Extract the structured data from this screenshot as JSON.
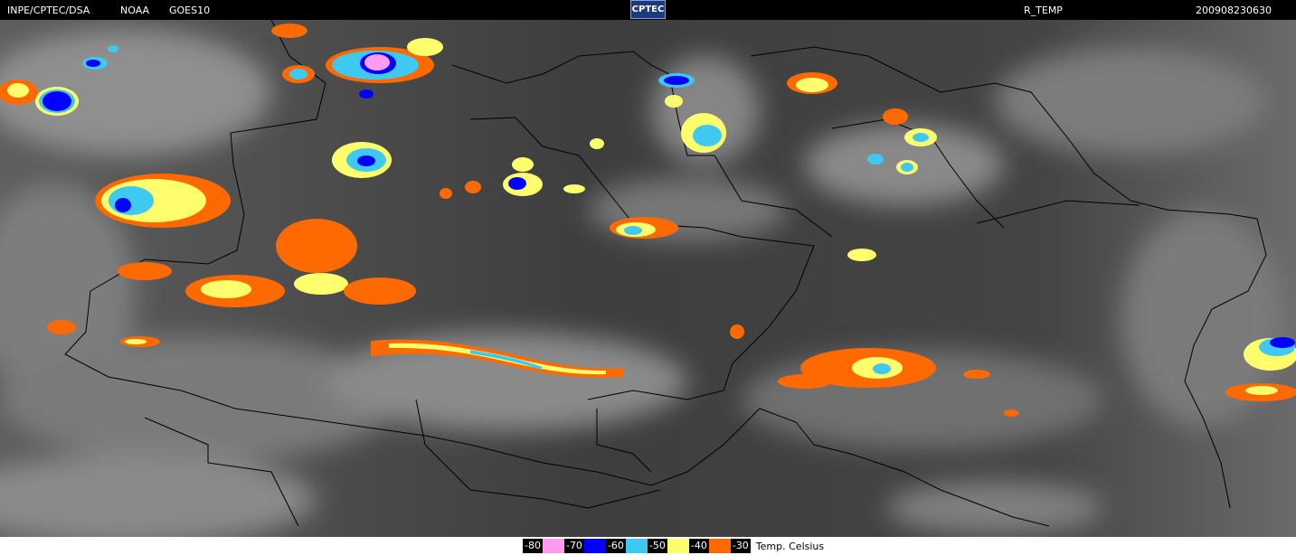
{
  "header": {
    "org": "INPE/CPTEC/DSA",
    "agency": "NOAA",
    "satellite": "GOES10",
    "logo_text": "CPTEC",
    "product": "R_TEMP",
    "timestamp": "200908230630"
  },
  "legend": {
    "title": "Temp. Celsius",
    "entries": [
      {
        "value": "-80",
        "color": "#ff9cf2"
      },
      {
        "value": "-70",
        "color": "#0000ff"
      },
      {
        "value": "-60",
        "color": "#3fc8f0"
      },
      {
        "value": "-50",
        "color": "#ffff6e"
      },
      {
        "value": "-40",
        "color": "#ff6a00"
      },
      {
        "value": "-30",
        "color": null
      }
    ]
  },
  "colors": {
    "background_cloud_dark": "#3a3a3a",
    "border_lines": "#000000",
    "minus80": "#ff9cf2",
    "minus70": "#0000ff",
    "minus60": "#3fc8f0",
    "minus50": "#ffff6e",
    "minus40": "#ff6a00"
  }
}
